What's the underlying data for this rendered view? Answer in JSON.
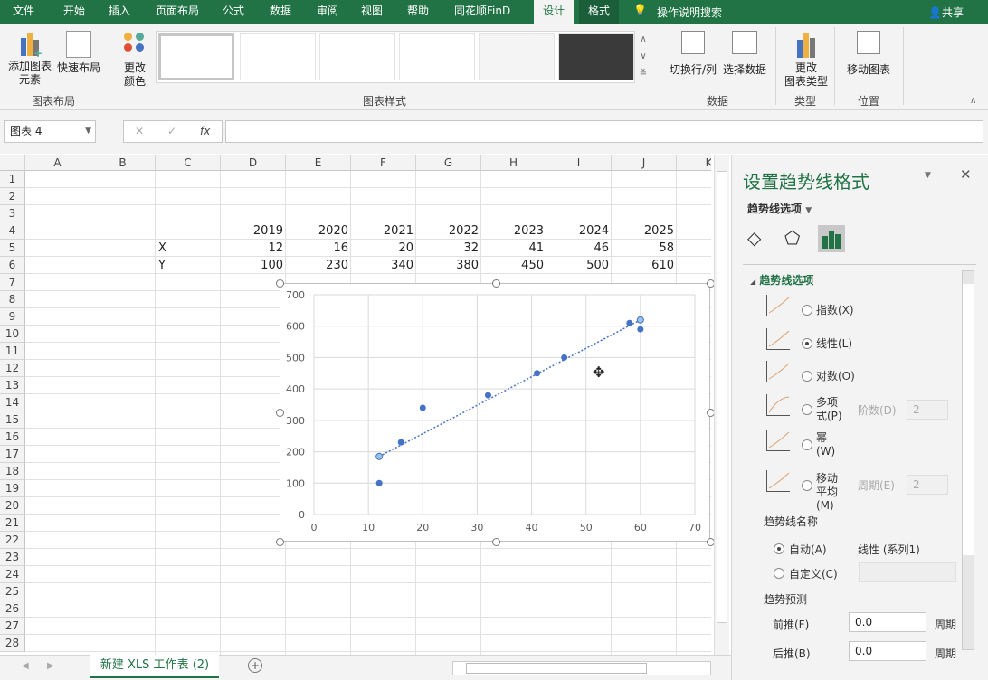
{
  "menu": {
    "tabs": [
      "文件",
      "开始",
      "插入",
      "页面布局",
      "公式",
      "数据",
      "审阅",
      "视图",
      "帮助",
      "同花顺FinD",
      "设计",
      "格式"
    ],
    "active": "设计",
    "search": "操作说明搜索",
    "share": "共享"
  },
  "ribbon": {
    "add_element": "添加图表",
    "add_element2": "元素",
    "quick_layout": "快速布局",
    "group_layout": "图表布局",
    "change_color": "更改",
    "change_color2": "颜色",
    "group_styles": "图表样式",
    "switch_rowcol": "切换行/列",
    "select_data": "选择数据",
    "group_data": "数据",
    "change_type": "更改",
    "change_type2": "图表类型",
    "group_type": "类型",
    "move_chart": "移动图表",
    "group_location": "位置"
  },
  "formula_bar": {
    "name_box": "图表 4",
    "fx": "fx",
    "formula": ""
  },
  "columns": [
    "A",
    "B",
    "C",
    "D",
    "E",
    "F",
    "G",
    "H",
    "I",
    "J",
    "K"
  ],
  "rows": [
    "1",
    "2",
    "3",
    "4",
    "5",
    "6",
    "7",
    "8",
    "9",
    "10",
    "11",
    "12",
    "13",
    "14",
    "15",
    "16",
    "17",
    "18",
    "19",
    "20",
    "21",
    "22",
    "23",
    "24",
    "25",
    "26",
    "27",
    "28"
  ],
  "cells": {
    "years": [
      "2019",
      "2020",
      "2021",
      "2022",
      "2023",
      "2024",
      "2025"
    ],
    "x_label": "X",
    "x_values": [
      "12",
      "16",
      "20",
      "32",
      "41",
      "46",
      "58"
    ],
    "y_label": "Y",
    "y_values": [
      "100",
      "230",
      "340",
      "380",
      "450",
      "500",
      "610"
    ]
  },
  "chart_data": {
    "type": "scatter",
    "x": [
      12,
      16,
      20,
      32,
      41,
      46,
      58,
      60
    ],
    "y": [
      100,
      230,
      340,
      380,
      450,
      500,
      610,
      590
    ],
    "xlim": [
      0,
      70
    ],
    "ylim": [
      0,
      700
    ],
    "xticks": [
      "0",
      "10",
      "20",
      "30",
      "40",
      "50",
      "60",
      "70"
    ],
    "yticks": [
      "0",
      "100",
      "200",
      "300",
      "400",
      "500",
      "600",
      "700"
    ],
    "grid": true,
    "trendline": {
      "type": "linear",
      "x": [
        12,
        60
      ],
      "y": [
        185,
        620
      ]
    },
    "colors": {
      "points": "#4472c4",
      "trendline": "#4472c4"
    }
  },
  "panel": {
    "title": "设置趋势线格式",
    "options_menu": "趋势线选项",
    "section": "趋势线选项",
    "types": [
      "指数(X)",
      "线性(L)",
      "对数(O)",
      "多项式(P)",
      "幂(W)",
      "移动平均(M)"
    ],
    "selected": "线性(L)",
    "order_label": "阶数(D)",
    "order_value": "2",
    "period_label": "周期(E)",
    "period_value": "2",
    "name_section": "趋势线名称",
    "auto": "自动(A)",
    "auto_value": "线性 (系列1)",
    "custom": "自定义(C)",
    "forecast_section": "趋势预测",
    "forward": "前推(F)",
    "forward_value": "0.0",
    "backward": "后推(B)",
    "backward_value": "0.0",
    "unit": "周期"
  },
  "sheet": {
    "tab": "新建 XLS 工作表 (2)"
  },
  "colors": {
    "brand": "#217346"
  }
}
